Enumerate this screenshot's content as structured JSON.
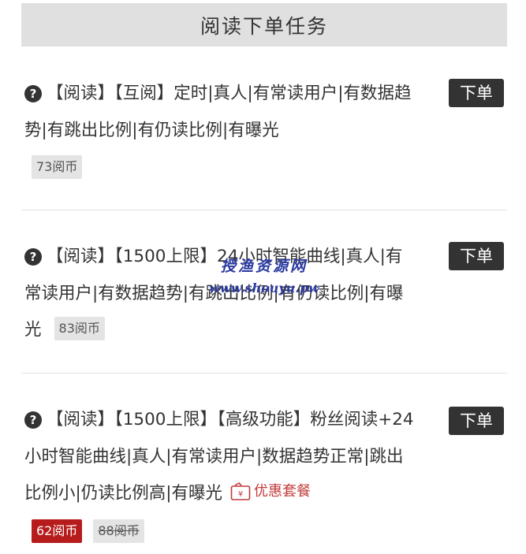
{
  "header": {
    "title": "阅读下单任务"
  },
  "icons": {
    "help": "help-circle-icon",
    "promo": "coupon-icon"
  },
  "colors": {
    "sale_red": "#b71c1c",
    "dark": "#333333",
    "watermark": "#2a3aa0"
  },
  "tasks": [
    {
      "description": "【阅读】【互阅】定时|真人|有常读用户|有数据趋势|有跳出比例|有仍读比例|有曝光",
      "order_label": "下单",
      "price": "73阅币"
    },
    {
      "description": "【阅读】【1500上限】24小时智能曲线|真人|有常读用户|有数据趋势|有跳出比例|有仍读比例|有曝光",
      "order_label": "下单",
      "price": "83阅币"
    },
    {
      "description": "【阅读】【1500上限】【高级功能】粉丝阅读+24小时智能曲线|真人|有常读用户|数据趋势正常|跳出比例小|仍读比例高|有曝光",
      "order_label": "下单",
      "promo_label": "优惠套餐",
      "sale_price": "62阅币",
      "original_price": "88阅币"
    }
  ],
  "watermark": {
    "line1": "授渔资源网",
    "line2": "www.shouyu.pw"
  }
}
